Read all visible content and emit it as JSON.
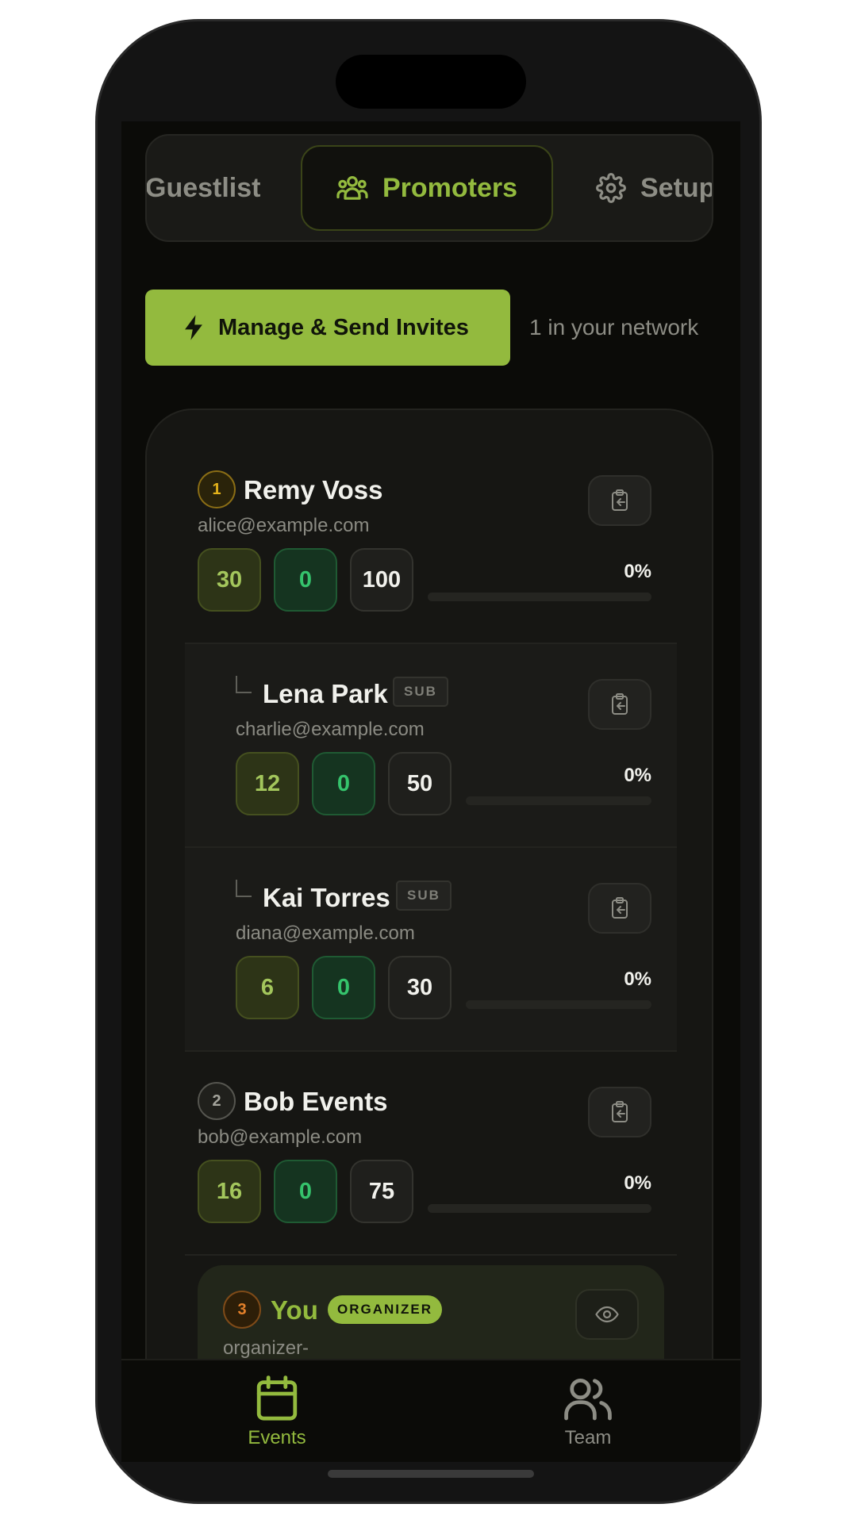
{
  "tabs": [
    {
      "label": "Guestlist",
      "icon": "list-icon",
      "active": false
    },
    {
      "label": "Promoters",
      "icon": "users-icon",
      "active": true
    },
    {
      "label": "Setup",
      "icon": "gear-icon",
      "active": false
    }
  ],
  "actions": {
    "invite_label": "Manage & Send Invites",
    "network_text": "1 in your network"
  },
  "promoters": [
    {
      "rank": "1",
      "name": "Remy Voss",
      "email": "alice@example.com",
      "stats": [
        "30",
        "0",
        "100"
      ],
      "pct": "0%",
      "progress": 0
    },
    {
      "name": "Lena Park",
      "badge": "SUB",
      "email": "charlie@example.com",
      "stats": [
        "12",
        "0",
        "50"
      ],
      "pct": "0%",
      "progress": 0
    },
    {
      "name": "Kai Torres",
      "badge": "SUB",
      "email": "diana@example.com",
      "stats": [
        "6",
        "0",
        "30"
      ],
      "pct": "0%",
      "progress": 0
    },
    {
      "rank": "2",
      "name": "Bob Events",
      "email": "bob@example.com",
      "stats": [
        "16",
        "0",
        "75"
      ],
      "pct": "0%",
      "progress": 0
    }
  ],
  "organizer": {
    "rank": "3",
    "name": "You",
    "badge": "ORGANIZER",
    "email": "organizer-"
  },
  "nav": [
    {
      "label": "Events",
      "icon": "calendar-icon",
      "active": true
    },
    {
      "label": "Team",
      "icon": "team-icon",
      "active": false
    }
  ],
  "colors": {
    "accent": "#93ba3e",
    "background": "#0b0b08",
    "success": "#35c36c",
    "rank_gold": "#e3b21b",
    "rank_orange": "#e4802a"
  }
}
